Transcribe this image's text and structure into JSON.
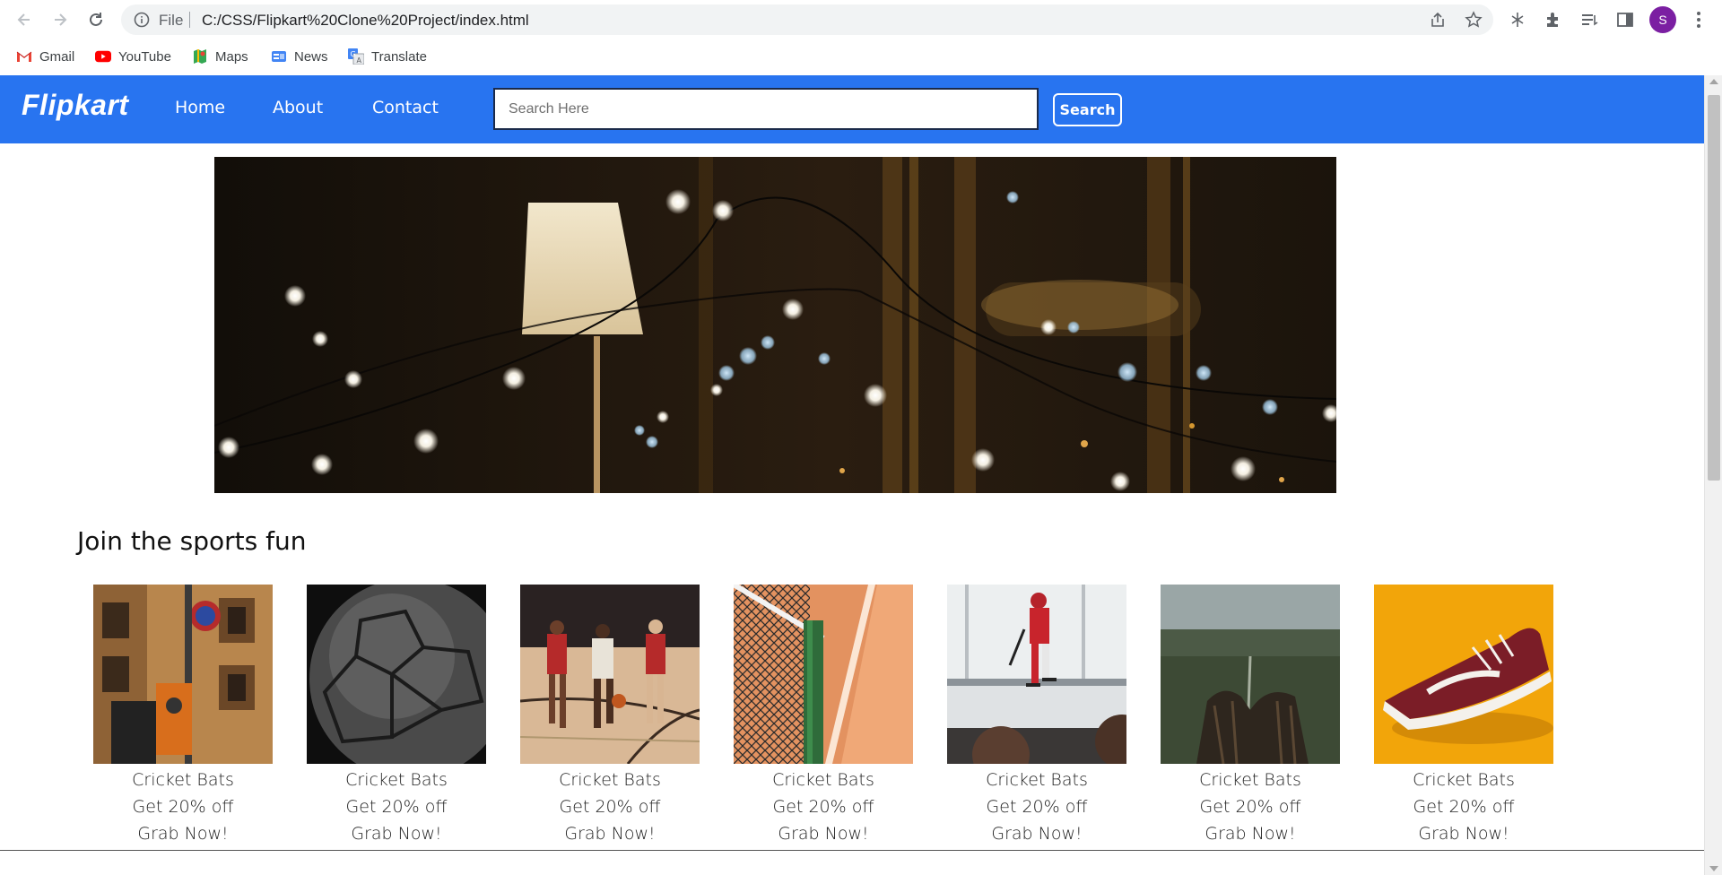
{
  "browser": {
    "url_scheme": "File",
    "url": "C:/CSS/Flipkart%20Clone%20Project/index.html",
    "profile_initial": "S",
    "bookmarks": [
      {
        "label": "Gmail",
        "icon": "gmail-icon"
      },
      {
        "label": "YouTube",
        "icon": "youtube-icon"
      },
      {
        "label": "Maps",
        "icon": "maps-icon"
      },
      {
        "label": "News",
        "icon": "news-icon"
      },
      {
        "label": "Translate",
        "icon": "translate-icon"
      }
    ]
  },
  "site": {
    "logo": "Flipkart",
    "nav": [
      {
        "label": "Home"
      },
      {
        "label": "About"
      },
      {
        "label": "Contact"
      }
    ],
    "search": {
      "placeholder": "Search Here",
      "button_label": "Search"
    },
    "brand_color": "#2874f0"
  },
  "section": {
    "title": "Join the sports fun",
    "cards": [
      {
        "name": "Cricket Bats",
        "offer": "Get 20% off",
        "cta": "Grab Now!",
        "image": "street-signal-photo"
      },
      {
        "name": "Cricket Bats",
        "offer": "Get 20% off",
        "cta": "Grab Now!",
        "image": "soccer-ball-photo"
      },
      {
        "name": "Cricket Bats",
        "offer": "Get 20% off",
        "cta": "Grab Now!",
        "image": "basketball-game-photo"
      },
      {
        "name": "Cricket Bats",
        "offer": "Get 20% off",
        "cta": "Grab Now!",
        "image": "tennis-net-photo"
      },
      {
        "name": "Cricket Bats",
        "offer": "Get 20% off",
        "cta": "Grab Now!",
        "image": "ice-hockey-photo"
      },
      {
        "name": "Cricket Bats",
        "offer": "Get 20% off",
        "cta": "Grab Now!",
        "image": "baseball-glove-photo"
      },
      {
        "name": "Cricket Bats",
        "offer": "Get 20% off",
        "cta": "Grab Now!",
        "image": "red-sneaker-photo"
      }
    ]
  }
}
